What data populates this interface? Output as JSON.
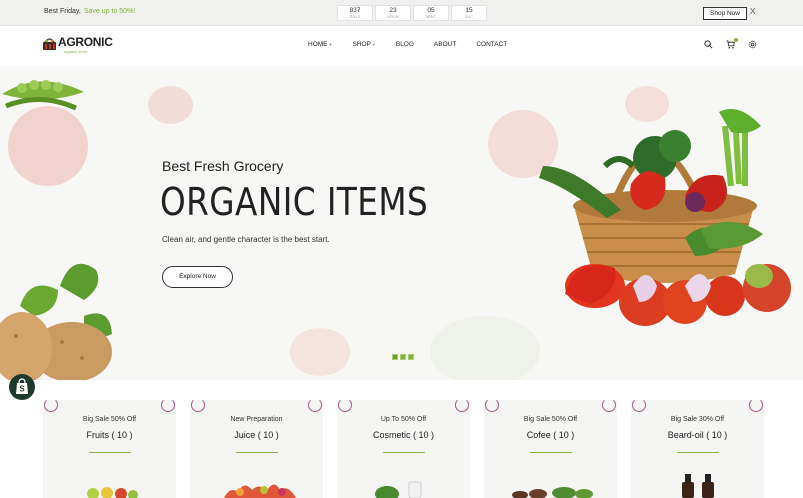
{
  "announcement": {
    "text": "Best Friday,",
    "highlight": "Save up to 50%!",
    "countdown": [
      {
        "value": "837",
        "label": "DAYS"
      },
      {
        "value": "23",
        "label": "HOUR"
      },
      {
        "value": "05",
        "label": "MINT"
      },
      {
        "value": "15",
        "label": "SEC"
      }
    ],
    "button": "Shop Now",
    "close": "X"
  },
  "header": {
    "logo": "AGRONIC",
    "tagline": "organic store",
    "nav": [
      {
        "label": "HOME",
        "dropdown": true
      },
      {
        "label": "SHOP",
        "dropdown": true
      },
      {
        "label": "BLOG",
        "dropdown": false
      },
      {
        "label": "ABOUT",
        "dropdown": false
      },
      {
        "label": "CONTACT",
        "dropdown": false
      }
    ],
    "icons": [
      "search-icon",
      "cart-icon",
      "settings-icon"
    ]
  },
  "hero": {
    "subtitle": "Best Fresh Grocery",
    "title": "ORGANIC ITEMS",
    "description": "Clean air, and gentle character is the best start.",
    "button": "Explore Now",
    "slides": 3,
    "active_slide": 1
  },
  "categories": [
    {
      "offer": "Big Sale 50% Off",
      "name": "Fruits ( 10 )"
    },
    {
      "offer": "New Preparation",
      "name": "Juice ( 10 )"
    },
    {
      "offer": "Up To 50% Off",
      "name": "Cosmetic ( 10 )"
    },
    {
      "offer": "Big Sale 50% Off",
      "name": "Cofee ( 10 )"
    },
    {
      "offer": "Big Sale 30% Off",
      "name": "Beard-oil ( 10 )"
    }
  ],
  "colors": {
    "accent": "#7fb33a",
    "ring": "#a8588f",
    "dark": "#222222"
  }
}
